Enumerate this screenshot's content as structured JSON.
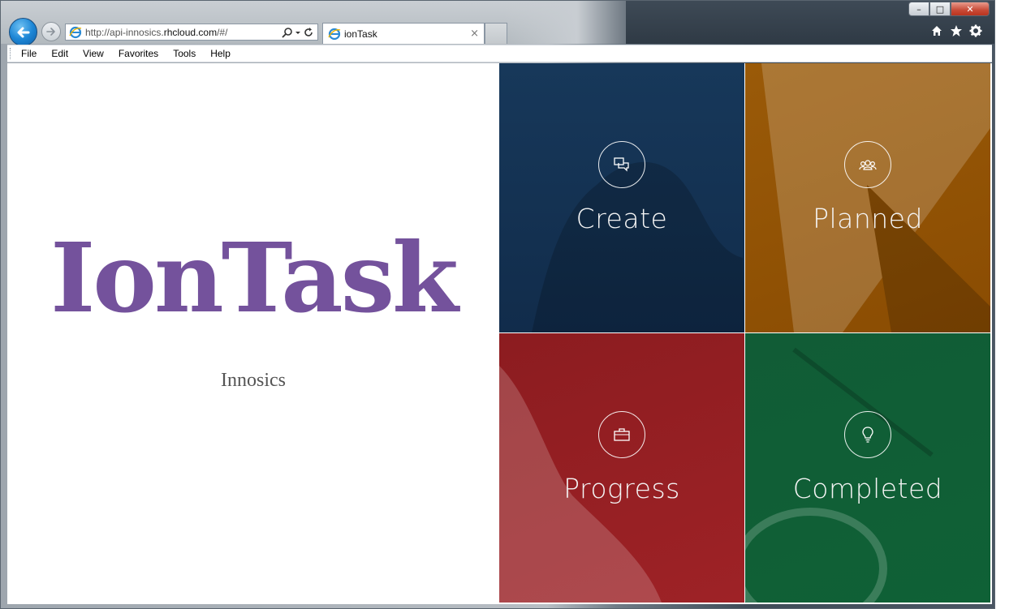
{
  "browser": {
    "url_prefix": "http://api-innosics.",
    "url_domain": "rhcloud.com",
    "url_suffix": "/#/",
    "tab_title": "ionTask",
    "tab_close": "×",
    "caption_min": "–",
    "caption_max": "□",
    "caption_close": "✕"
  },
  "menu": {
    "items": [
      {
        "label": "File"
      },
      {
        "label": "Edit"
      },
      {
        "label": "View"
      },
      {
        "label": "Favorites"
      },
      {
        "label": "Tools"
      },
      {
        "label": "Help"
      }
    ]
  },
  "page": {
    "brand": "IonTask",
    "subtitle": "Innosics",
    "tiles": [
      {
        "label": "Create",
        "icon": "chat-icon",
        "color": "#123257"
      },
      {
        "label": "Planned",
        "icon": "group-icon",
        "color": "#8f5004"
      },
      {
        "label": "Progress",
        "icon": "briefcase-icon",
        "color": "#951f23"
      },
      {
        "label": "Completed",
        "icon": "lightbulb-icon",
        "color": "#0f5e36"
      }
    ]
  },
  "colors": {
    "brand": "#74529c",
    "ie_blue": "#1e87d6"
  }
}
